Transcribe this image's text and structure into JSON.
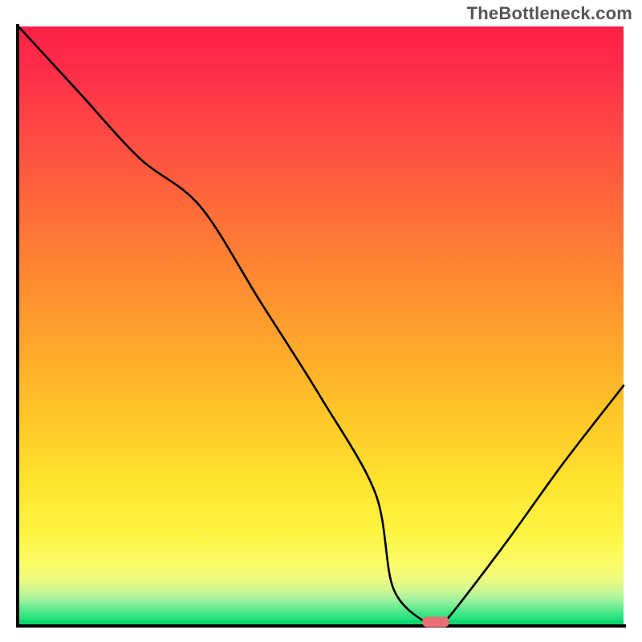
{
  "watermark": "TheBottleneck.com",
  "chart_data": {
    "type": "line",
    "title": "",
    "xlabel": "",
    "ylabel": "",
    "xlim": [
      0,
      100
    ],
    "ylim": [
      0,
      100
    ],
    "grid": false,
    "legend": false,
    "series": [
      {
        "name": "bottleneck-curve",
        "x": [
          0,
          10,
          20,
          30,
          40,
          50,
          59,
          62,
          68,
          70,
          80,
          90,
          100
        ],
        "y": [
          100,
          89,
          78,
          70,
          54,
          38,
          22,
          6,
          0,
          0,
          13,
          27,
          40
        ]
      }
    ],
    "marker": {
      "x": 69,
      "y": 0.5,
      "name": "optimal-point"
    },
    "background_gradient": {
      "top": "#ff1f48",
      "mid": "#ffe32e",
      "bottom": "#07d86d"
    }
  }
}
